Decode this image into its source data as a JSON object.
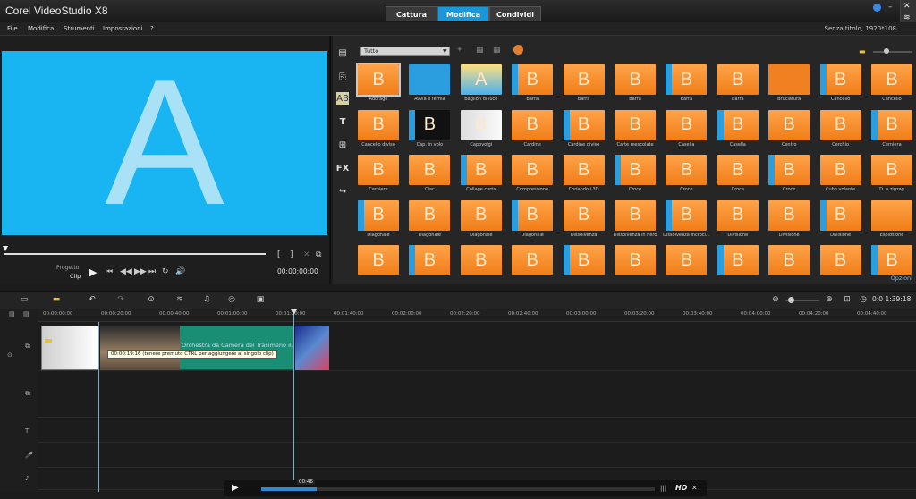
{
  "app": {
    "title": "Corel VideoStudio X8",
    "project_title": "Senza titolo, 1920*108"
  },
  "mode_tabs": [
    {
      "label": "Cattura"
    },
    {
      "label": "Modifica"
    },
    {
      "label": "Condividi"
    }
  ],
  "menu": [
    {
      "label": "File"
    },
    {
      "label": "Modifica"
    },
    {
      "label": "Strumenti"
    },
    {
      "label": "Impostazioni"
    },
    {
      "label": "?"
    }
  ],
  "preview": {
    "letter": "A",
    "mode_project": "Progetto",
    "mode_clip": "Clip",
    "timecode": "00:00:00:00"
  },
  "library": {
    "category_selected": "Tutto",
    "options_label": "Opzioni",
    "side_icons": [
      "media-icon",
      "instant-project-icon",
      "transition-icon",
      "title-icon",
      "graphic-icon",
      "filter-icon",
      "path-icon"
    ],
    "tiles": [
      {
        "label": "Adorage",
        "letter": "B"
      },
      {
        "label": "Avvia e ferma",
        "letter": ""
      },
      {
        "label": "Bagliori di luce",
        "letter": "A"
      },
      {
        "label": "Barra",
        "letter": "B"
      },
      {
        "label": "Barra",
        "letter": "B"
      },
      {
        "label": "Barra",
        "letter": "B"
      },
      {
        "label": "Barra",
        "letter": "B"
      },
      {
        "label": "Barra",
        "letter": "B"
      },
      {
        "label": "Bruciatura",
        "letter": ""
      },
      {
        "label": "Cancello",
        "letter": "B"
      },
      {
        "label": "Cancello",
        "letter": "B"
      },
      {
        "label": "Cancello diviso",
        "letter": "B"
      },
      {
        "label": "Cap. in volo",
        "letter": "B"
      },
      {
        "label": "Capovolgi",
        "letter": "B"
      },
      {
        "label": "Cardine",
        "letter": "B"
      },
      {
        "label": "Cardine diviso",
        "letter": "B"
      },
      {
        "label": "Carte mescolate",
        "letter": "B"
      },
      {
        "label": "Casella",
        "letter": "B"
      },
      {
        "label": "Casella",
        "letter": "B"
      },
      {
        "label": "Centro",
        "letter": "B"
      },
      {
        "label": "Cerchio",
        "letter": "B"
      },
      {
        "label": "Cerniera",
        "letter": "B"
      },
      {
        "label": "Cerniera",
        "letter": "B"
      },
      {
        "label": "Clac",
        "letter": "B"
      },
      {
        "label": "Collage carta",
        "letter": "B"
      },
      {
        "label": "Compressione",
        "letter": "B"
      },
      {
        "label": "Coriandoli 3D",
        "letter": "B"
      },
      {
        "label": "Croce",
        "letter": "B"
      },
      {
        "label": "Croce",
        "letter": "B"
      },
      {
        "label": "Croce",
        "letter": "B"
      },
      {
        "label": "Croce",
        "letter": "B"
      },
      {
        "label": "Cubo volante",
        "letter": "B"
      },
      {
        "label": "D. a zigzag",
        "letter": "B"
      },
      {
        "label": "Diagonale",
        "letter": "B"
      },
      {
        "label": "Diagonale",
        "letter": "B"
      },
      {
        "label": "Diagonale",
        "letter": "B"
      },
      {
        "label": "Diagonale",
        "letter": "B"
      },
      {
        "label": "Dissolvenza",
        "letter": "B"
      },
      {
        "label": "Dissolvenza in nero",
        "letter": "B"
      },
      {
        "label": "Dissolvenza incroci...",
        "letter": "B"
      },
      {
        "label": "Divisione",
        "letter": "B"
      },
      {
        "label": "Divisione",
        "letter": "B"
      },
      {
        "label": "Divisione",
        "letter": "B"
      },
      {
        "label": "Esplosione",
        "letter": ""
      },
      {
        "label": "",
        "letter": "B"
      },
      {
        "label": "",
        "letter": "B"
      },
      {
        "label": "",
        "letter": "B"
      },
      {
        "label": "",
        "letter": "B"
      },
      {
        "label": "",
        "letter": "B"
      },
      {
        "label": "",
        "letter": "B"
      },
      {
        "label": "",
        "letter": "B"
      },
      {
        "label": "",
        "letter": "B"
      },
      {
        "label": "",
        "letter": "B"
      },
      {
        "label": "",
        "letter": "B"
      },
      {
        "label": "",
        "letter": "B"
      }
    ]
  },
  "timeline": {
    "timecode": "0:0 1:39:18",
    "ruler_ticks": [
      "00:00:00:00",
      "00:00:20:00",
      "00:00:40:00",
      "00:01:00:00",
      "00:01:20:00",
      "00:01:40:00",
      "00:02:00:00",
      "00:02:20:00",
      "00:02:40:00",
      "00:03:00:00",
      "00:03:20:00",
      "00:03:40:00",
      "00:04:00:00",
      "00:04:20:00",
      "00:04:40:00"
    ],
    "clip_label": "Orchestra da Camera del Trasimeno il...",
    "tooltip": "00:00:19:16 (tenere premuto CTRL per aggiungere al singolo clip)",
    "player_time": "00:46",
    "hd_label": "HD",
    "player_progress_fraction": 0.14
  }
}
